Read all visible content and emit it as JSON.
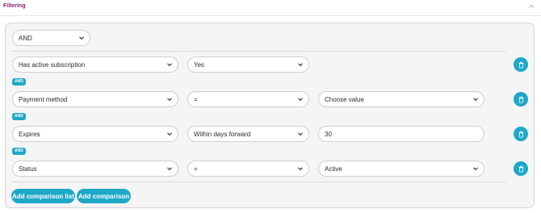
{
  "section": {
    "title": "Filtering"
  },
  "root_operator": "AND",
  "rows": [
    {
      "field": "Has active subscription",
      "operator": "Yes",
      "value": null
    },
    {
      "field": "Payment method",
      "operator": "=",
      "value": "Choose value"
    },
    {
      "field": "Expires",
      "operator": "Within days forward",
      "value": "30"
    },
    {
      "field": "Status",
      "operator": "=",
      "value": "Active"
    }
  ],
  "connector": "AND",
  "buttons": {
    "add_list": "Add comparison list",
    "add_comparison": "Add comparison"
  },
  "icons": {
    "collapse": "chevron-up-icon",
    "dropdown": "chevron-down-icon",
    "delete": "trash-icon"
  },
  "colors": {
    "accent": "#1ea8c8",
    "title": "#8a1b78"
  }
}
